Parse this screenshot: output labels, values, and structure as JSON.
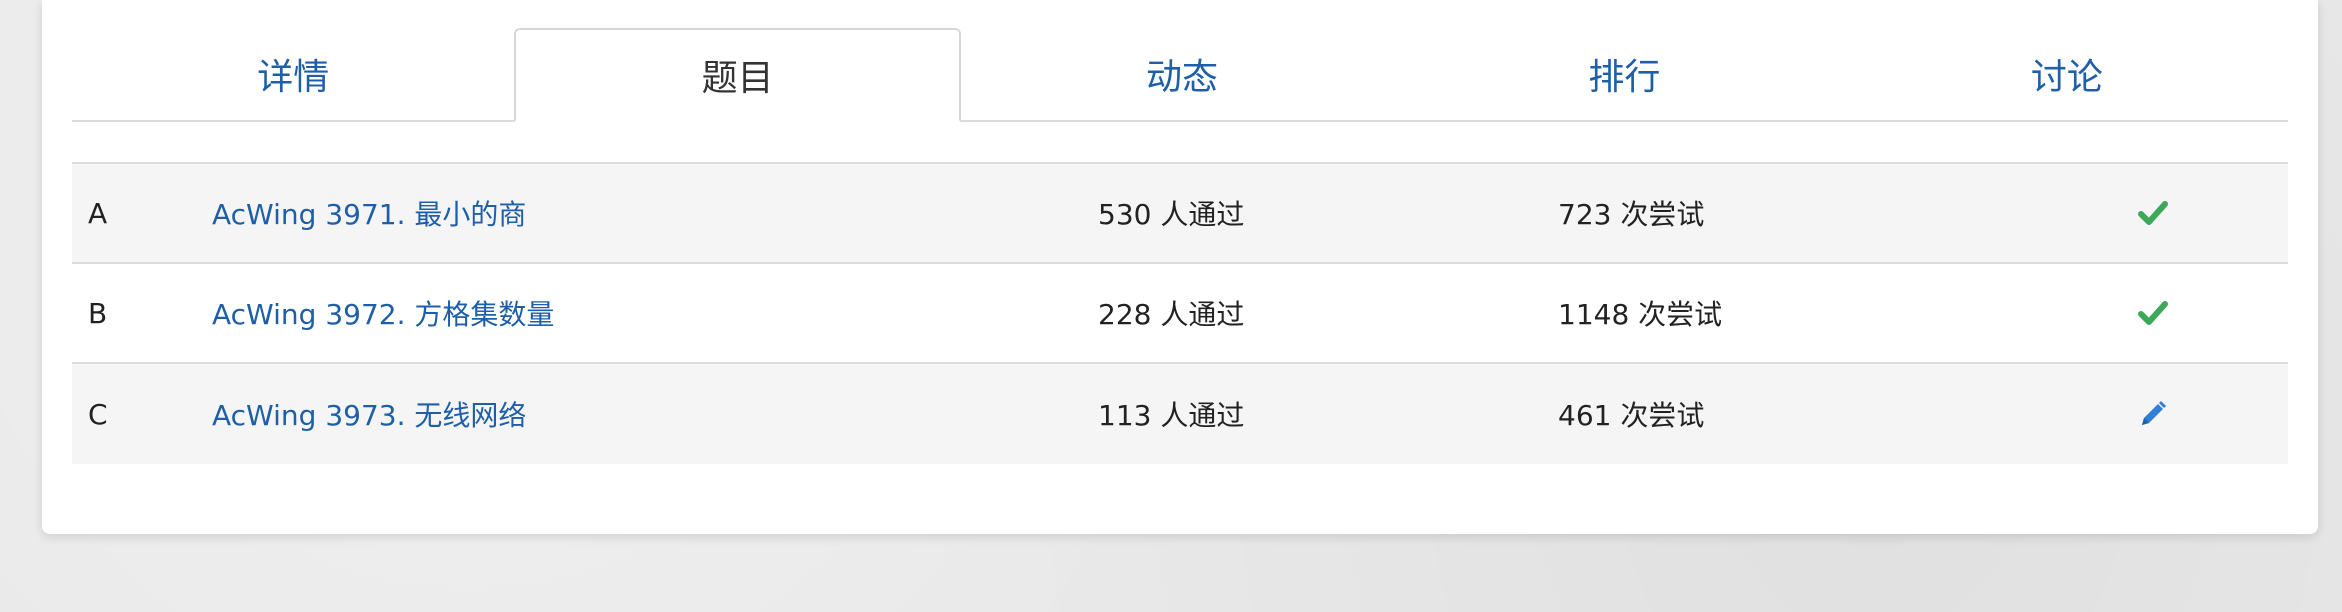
{
  "tabs": [
    {
      "label": "详情",
      "active": false
    },
    {
      "label": "题目",
      "active": true
    },
    {
      "label": "动态",
      "active": false
    },
    {
      "label": "排行",
      "active": false
    },
    {
      "label": "讨论",
      "active": false
    }
  ],
  "problems": [
    {
      "letter": "A",
      "title": "AcWing 3971. 最小的商",
      "passed": "530 人通过",
      "attempts": "723 次尝试",
      "status_icon": "check-icon",
      "status_color": "#3ea85a"
    },
    {
      "letter": "B",
      "title": "AcWing 3972. 方格集数量",
      "passed": "228 人通过",
      "attempts": "1148 次尝试",
      "status_icon": "check-icon",
      "status_color": "#3ea85a"
    },
    {
      "letter": "C",
      "title": "AcWing 3973. 无线网络",
      "passed": "113 人通过",
      "attempts": "461 次尝试",
      "status_icon": "pencil-icon",
      "status_color": "#2f7fd8"
    }
  ]
}
